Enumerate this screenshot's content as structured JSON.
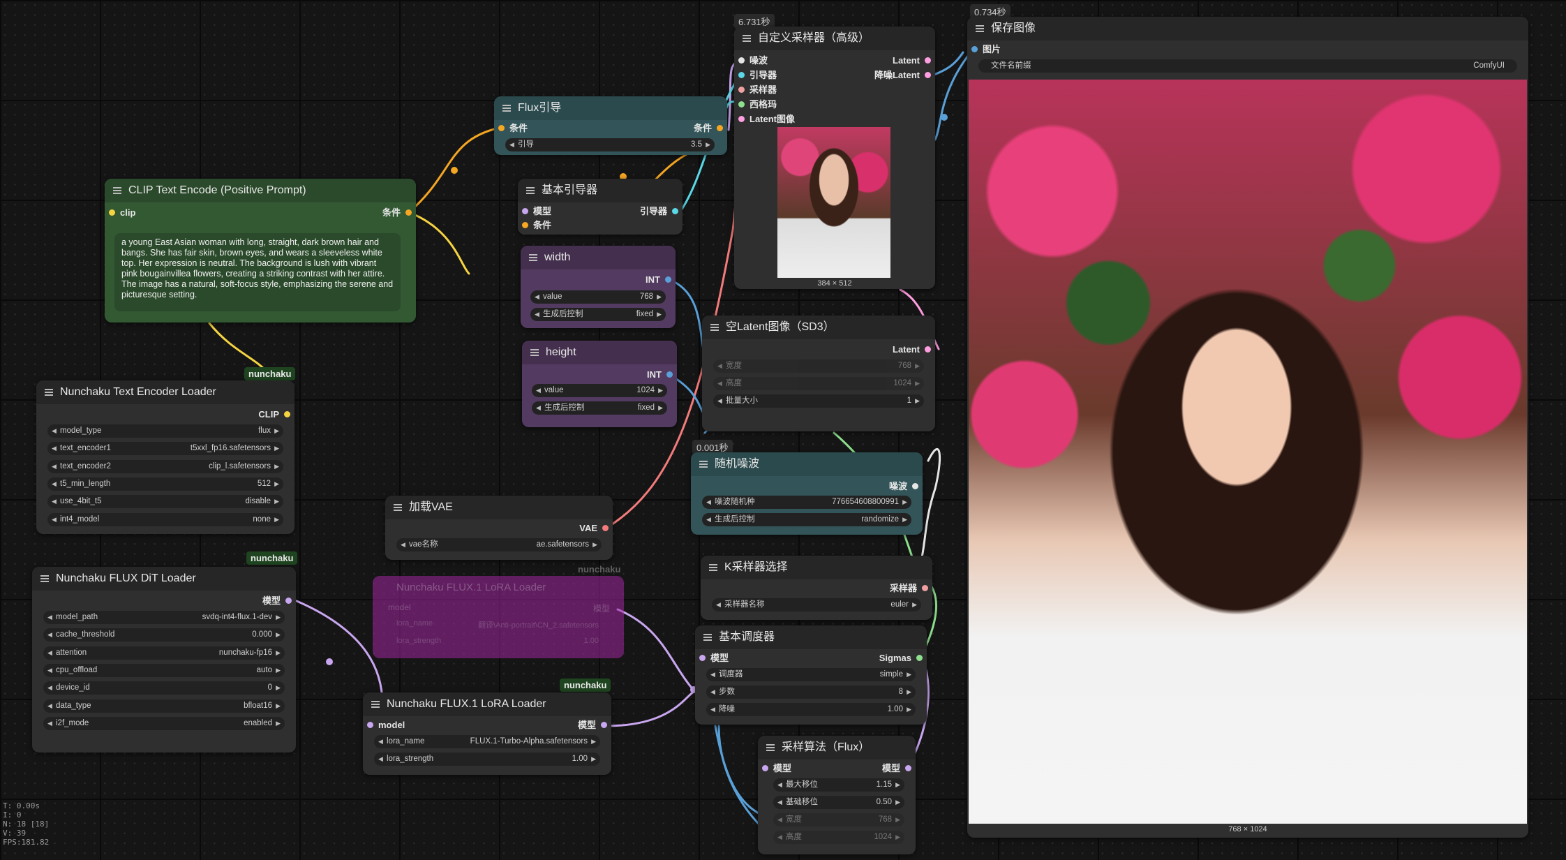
{
  "timings": {
    "sampler": "6.731秒",
    "save": "0.734秒",
    "noise": "0.001秒"
  },
  "tags": {
    "t1": "nunchaku",
    "t2": "nunchaku",
    "t3": "nunchaku",
    "t4": "nunchaku"
  },
  "clip_encode": {
    "title": "CLIP Text Encode (Positive Prompt)",
    "in_clip": "clip",
    "out_cond": "条件",
    "prompt": "a young East Asian woman with long, straight, dark brown hair and bangs. She has fair skin, brown eyes, and wears a sleeveless white top. Her expression is neutral. The background is lush with vibrant pink bougainvillea flowers, creating a striking contrast with her attire. The image has a natural, soft-focus style, emphasizing the serene and picturesque setting."
  },
  "text_loader": {
    "title": "Nunchaku Text Encoder Loader",
    "out": "CLIP",
    "widgets": [
      {
        "label": "model_type",
        "value": "flux"
      },
      {
        "label": "text_encoder1",
        "value": "t5xxl_fp16.safetensors"
      },
      {
        "label": "text_encoder2",
        "value": "clip_l.safetensors"
      },
      {
        "label": "t5_min_length",
        "value": "512"
      },
      {
        "label": "use_4bit_t5",
        "value": "disable"
      },
      {
        "label": "int4_model",
        "value": "none"
      }
    ]
  },
  "dit_loader": {
    "title": "Nunchaku FLUX DiT Loader",
    "out": "模型",
    "widgets": [
      {
        "label": "model_path",
        "value": "svdq-int4-flux.1-dev"
      },
      {
        "label": "cache_threshold",
        "value": "0.000"
      },
      {
        "label": "attention",
        "value": "nunchaku-fp16"
      },
      {
        "label": "cpu_offload",
        "value": "auto"
      },
      {
        "label": "device_id",
        "value": "0"
      },
      {
        "label": "data_type",
        "value": "bfloat16"
      },
      {
        "label": "i2f_mode",
        "value": "enabled"
      }
    ]
  },
  "flux_guide": {
    "title": "Flux引导",
    "in": "条件",
    "out": "条件",
    "w_label": "引导",
    "w_value": "3.5"
  },
  "basic_guider": {
    "title": "基本引导器",
    "in1": "模型",
    "in2": "条件",
    "out": "引导器"
  },
  "width_node": {
    "title": "width",
    "out": "INT",
    "w1_label": "value",
    "w1_value": "768",
    "w2_label": "生成后控制",
    "w2_value": "fixed"
  },
  "height_node": {
    "title": "height",
    "out": "INT",
    "w1_label": "value",
    "w1_value": "1024",
    "w2_label": "生成后控制",
    "w2_value": "fixed"
  },
  "vae_loader": {
    "title": "加载VAE",
    "out": "VAE",
    "w_label": "vae名称",
    "w_value": "ae.safetensors"
  },
  "lora_ghost": {
    "title": "Nunchaku FLUX.1 LoRA Loader",
    "in": "model",
    "out": "模型",
    "w1_label": "lora_name",
    "w1_value": "翻译\\Anti-portrait\\CN_2.safetensors",
    "w2_label": "lora_strength",
    "w2_value": "1.00"
  },
  "lora_loader": {
    "title": "Nunchaku FLUX.1 LoRA Loader",
    "in": "model",
    "out": "模型",
    "w1_label": "lora_name",
    "w1_value": "FLUX.1-Turbo-Alpha.safetensors",
    "w2_label": "lora_strength",
    "w2_value": "1.00"
  },
  "custom_sampler": {
    "title": "自定义采样器（高级）",
    "inputs": [
      "噪波",
      "引导器",
      "采样器",
      "西格玛",
      "Latent图像"
    ],
    "outputs": [
      "Latent",
      "降噪Latent"
    ],
    "preview_size": "384 × 512"
  },
  "empty_latent": {
    "title": "空Latent图像（SD3）",
    "out": "Latent",
    "w1_label": "宽度",
    "w1_value": "768",
    "w2_label": "高度",
    "w2_value": "1024",
    "w3_label": "批量大小",
    "w3_value": "1"
  },
  "random_noise": {
    "title": "随机噪波",
    "out": "噪波",
    "w1_label": "噪波随机种",
    "w1_value": "776654608800991",
    "w2_label": "生成后控制",
    "w2_value": "randomize"
  },
  "k_sampler_select": {
    "title": "K采样器选择",
    "out": "采样器",
    "w_label": "采样器名称",
    "w_value": "euler"
  },
  "basic_scheduler": {
    "title": "基本调度器",
    "in": "模型",
    "out": "Sigmas",
    "w1_label": "调度器",
    "w1_value": "simple",
    "w2_label": "步数",
    "w2_value": "8",
    "w3_label": "降噪",
    "w3_value": "1.00"
  },
  "model_sampling": {
    "title": "采样算法（Flux）",
    "in": "模型",
    "out": "模型",
    "w1_label": "最大移位",
    "w1_value": "1.15",
    "w2_label": "基础移位",
    "w2_value": "0.50",
    "w3_label": "宽度",
    "w3_value": "768",
    "w4_label": "高度",
    "w4_value": "1024"
  },
  "save_image": {
    "title": "保存图像",
    "in": "图片",
    "w_label": "文件名前缀",
    "w_value": "ComfyUI",
    "image_size": "768 × 1024"
  },
  "stats": {
    "l1": "T: 0.00s",
    "l2": "I: 0",
    "l3": "N: 18 [18]",
    "l4": "V: 39",
    "l5": "FPS:181.82"
  }
}
